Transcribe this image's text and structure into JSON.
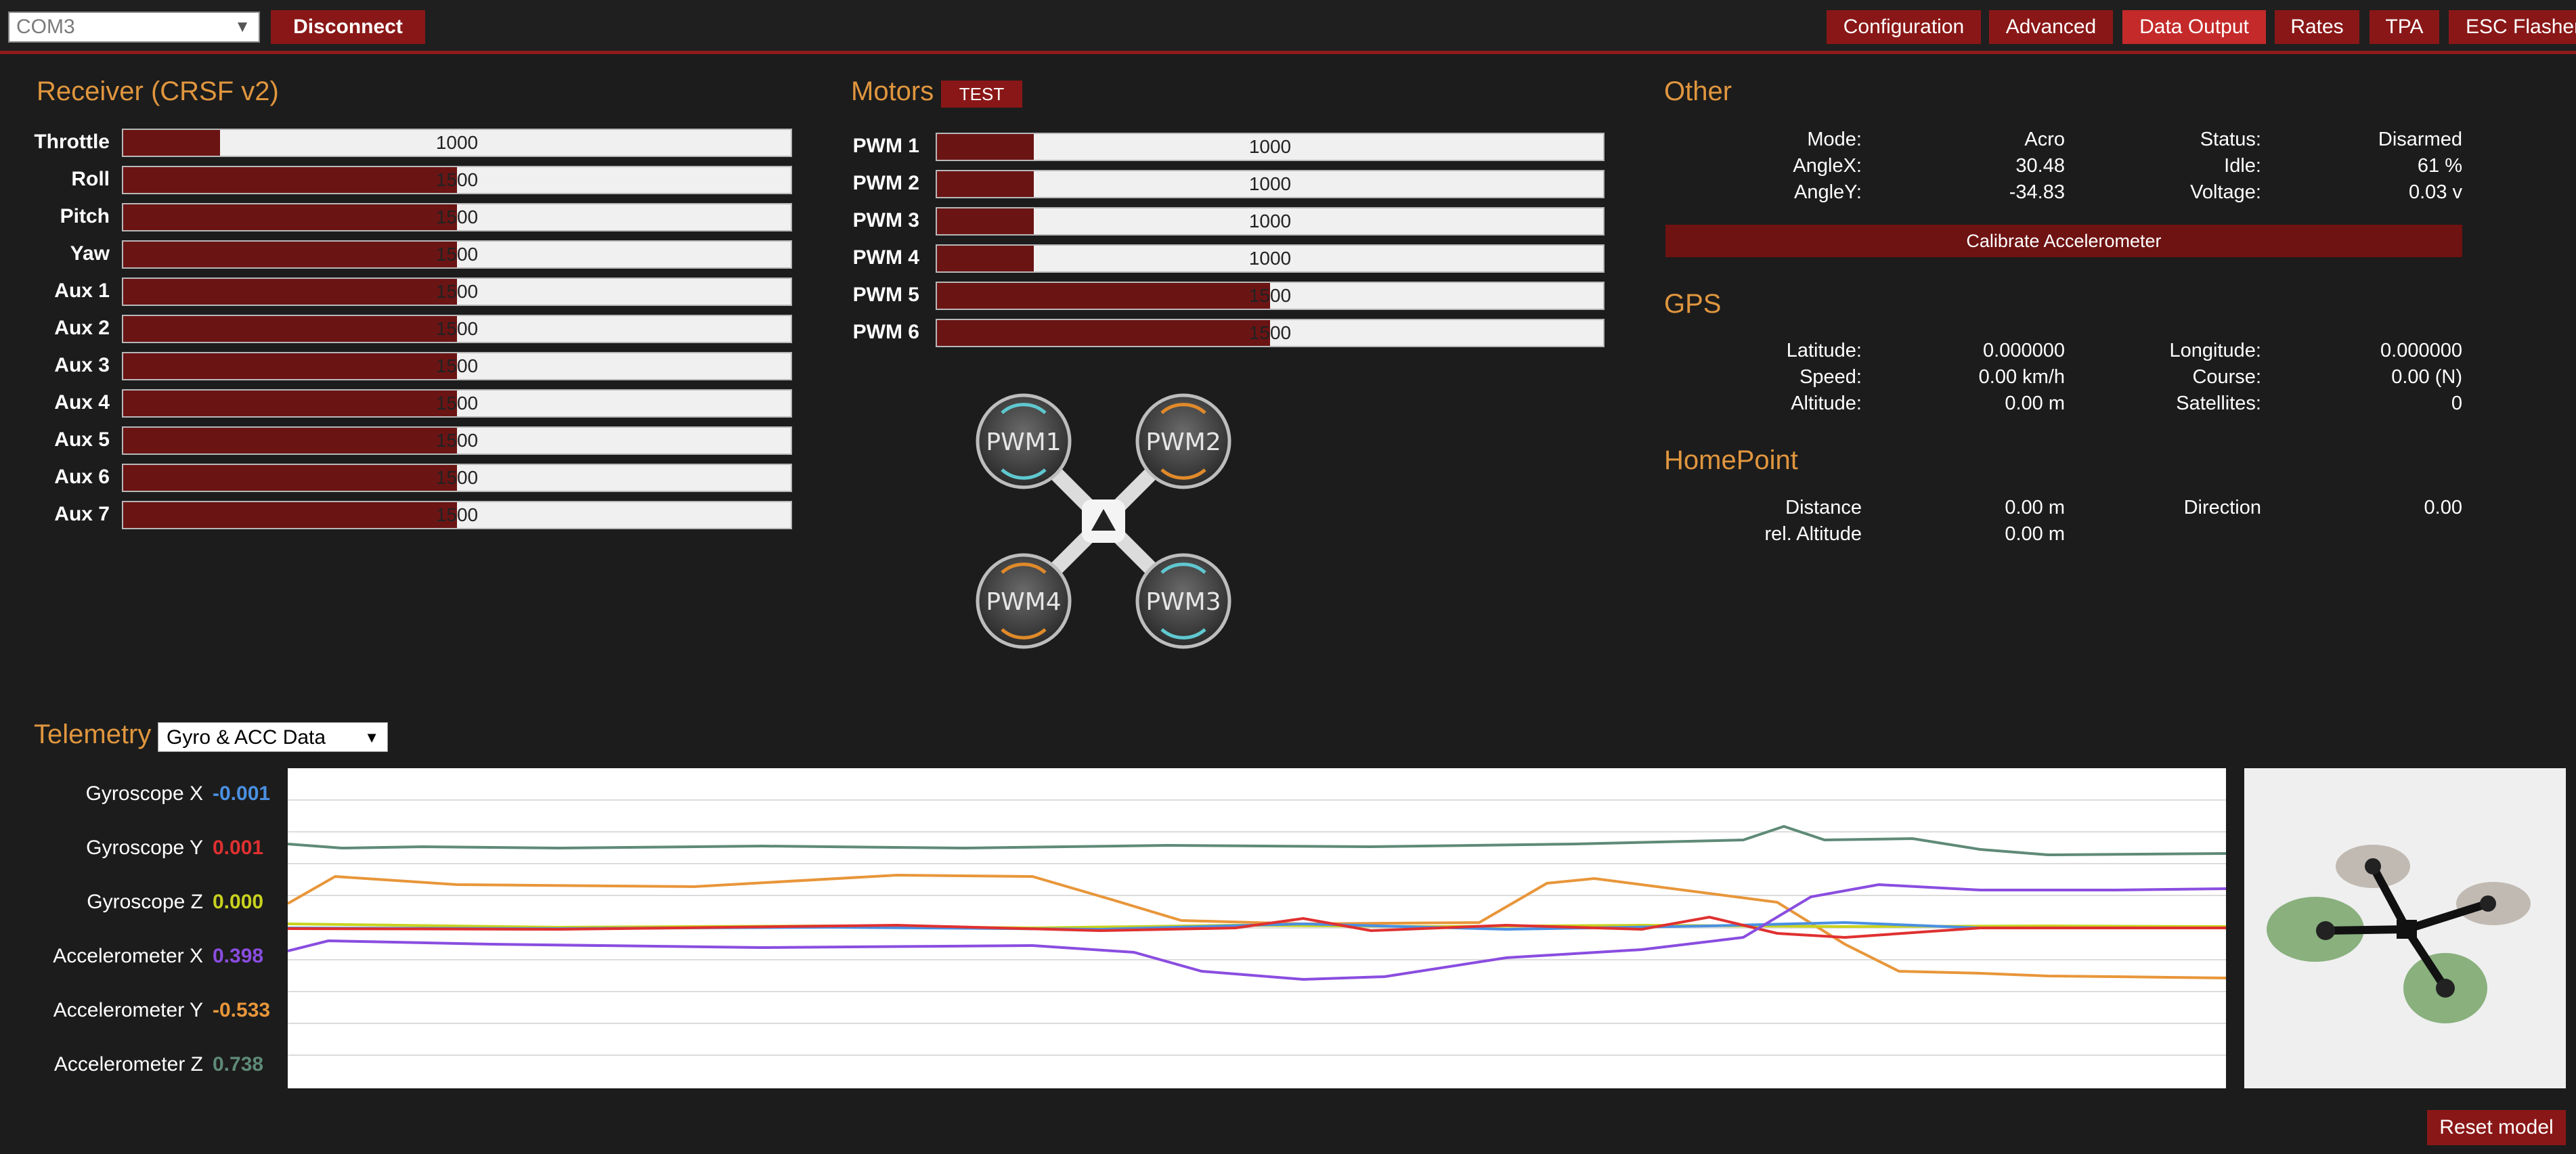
{
  "topbar": {
    "port_value": "COM3",
    "disconnect_label": "Disconnect",
    "tabs": [
      {
        "label": "Configuration",
        "active": false
      },
      {
        "label": "Advanced",
        "active": false
      },
      {
        "label": "Data Output",
        "active": true
      },
      {
        "label": "Rates",
        "active": false
      },
      {
        "label": "TPA",
        "active": false
      },
      {
        "label": "ESC Flasher",
        "active": false
      }
    ]
  },
  "receiver": {
    "title": "Receiver (CRSF v2)",
    "channels": [
      {
        "label": "Throttle",
        "value": "1000",
        "fraction": 0.0
      },
      {
        "label": "Roll",
        "value": "1500",
        "fraction": 0.5
      },
      {
        "label": "Pitch",
        "value": "1500",
        "fraction": 0.5
      },
      {
        "label": "Yaw",
        "value": "1500",
        "fraction": 0.5
      },
      {
        "label": "Aux 1",
        "value": "1500",
        "fraction": 0.5
      },
      {
        "label": "Aux 2",
        "value": "1500",
        "fraction": 0.5
      },
      {
        "label": "Aux 3",
        "value": "1500",
        "fraction": 0.5
      },
      {
        "label": "Aux 4",
        "value": "1500",
        "fraction": 0.5
      },
      {
        "label": "Aux 5",
        "value": "1500",
        "fraction": 0.5
      },
      {
        "label": "Aux 6",
        "value": "1500",
        "fraction": 0.5
      },
      {
        "label": "Aux 7",
        "value": "1500",
        "fraction": 0.5
      }
    ]
  },
  "motors": {
    "title": "Motors",
    "test_label": "TEST",
    "channels": [
      {
        "label": "PWM 1",
        "value": "1000",
        "fraction": 0.0
      },
      {
        "label": "PWM 2",
        "value": "1000",
        "fraction": 0.0
      },
      {
        "label": "PWM 3",
        "value": "1000",
        "fraction": 0.0
      },
      {
        "label": "PWM 4",
        "value": "1000",
        "fraction": 0.0
      },
      {
        "label": "PWM 5",
        "value": "1500",
        "fraction": 0.5
      },
      {
        "label": "PWM 6",
        "value": "1500",
        "fraction": 0.5
      }
    ],
    "diagram_labels": [
      "PWM1",
      "PWM2",
      "PWM3",
      "PWM4"
    ]
  },
  "other": {
    "title": "Other",
    "rows": [
      {
        "l1": "Mode:",
        "v1": "Acro",
        "l2": "Status:",
        "v2": "Disarmed"
      },
      {
        "l1": "AngleX:",
        "v1": "30.48",
        "l2": "Idle:",
        "v2": "61 %"
      },
      {
        "l1": "AngleY:",
        "v1": "-34.83",
        "l2": "Voltage:",
        "v2": "0.03 v"
      }
    ],
    "calibrate_label": "Calibrate Accelerometer"
  },
  "gps": {
    "title": "GPS",
    "rows": [
      {
        "l1": "Latitude:",
        "v1": "0.000000",
        "l2": "Longitude:",
        "v2": "0.000000"
      },
      {
        "l1": "Speed:",
        "v1": "0.00 km/h",
        "l2": "Course:",
        "v2": "0.00 (N)"
      },
      {
        "l1": "Altitude:",
        "v1": "0.00 m",
        "l2": "Satellites:",
        "v2": "0"
      }
    ]
  },
  "homepoint": {
    "title": "HomePoint",
    "rows": [
      {
        "l1": "Distance",
        "v1": "0.00 m",
        "l2": "Direction",
        "v2": "0.00"
      },
      {
        "l1": "rel. Altitude",
        "v1": "0.00 m",
        "l2": "",
        "v2": ""
      }
    ]
  },
  "telemetry": {
    "title": "Telemetry",
    "select_value": "Gyro & ACC Data",
    "series": [
      {
        "label": "Gyroscope X",
        "value": "-0.001",
        "color": "#4a90e2"
      },
      {
        "label": "Gyroscope Y",
        "value": "0.001",
        "color": "#e03030"
      },
      {
        "label": "Gyroscope Z",
        "value": "0.000",
        "color": "#c8d21e"
      },
      {
        "label": "Accelerometer X",
        "value": "0.398",
        "color": "#8a4de0"
      },
      {
        "label": "Accelerometer Y",
        "value": "-0.533",
        "color": "#e8963a"
      },
      {
        "label": "Accelerometer Z",
        "value": "0.738",
        "color": "#5f8a78"
      }
    ],
    "reset_label": "Reset model"
  }
}
